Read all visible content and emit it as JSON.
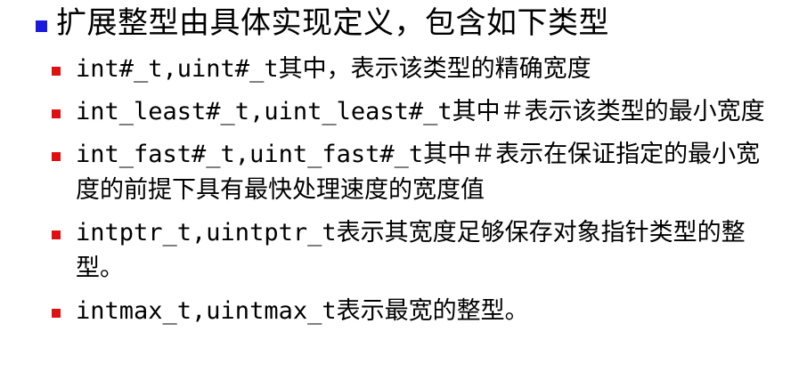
{
  "colors": {
    "heading_bullet": "#1a1adf",
    "item_bullet": "#e01010",
    "text": "#000000",
    "background": "#ffffff"
  },
  "heading": {
    "text": "扩展整型由具体实现定义，包含如下类型"
  },
  "items": [
    {
      "text": "int#_t,uint#_t其中，表示该类型的精确宽度"
    },
    {
      "text": "int_least#_t,uint_least#_t其中＃表示该类型的最小宽度"
    },
    {
      "text": "int_fast#_t,uint_fast#_t其中＃表示在保证指定的最小宽度的前提下具有最快处理速度的宽度值"
    },
    {
      "text": "intptr_t,uintptr_t表示其宽度足够保存对象指针类型的整型。"
    },
    {
      "text": "intmax_t,uintmax_t表示最宽的整型。"
    }
  ]
}
